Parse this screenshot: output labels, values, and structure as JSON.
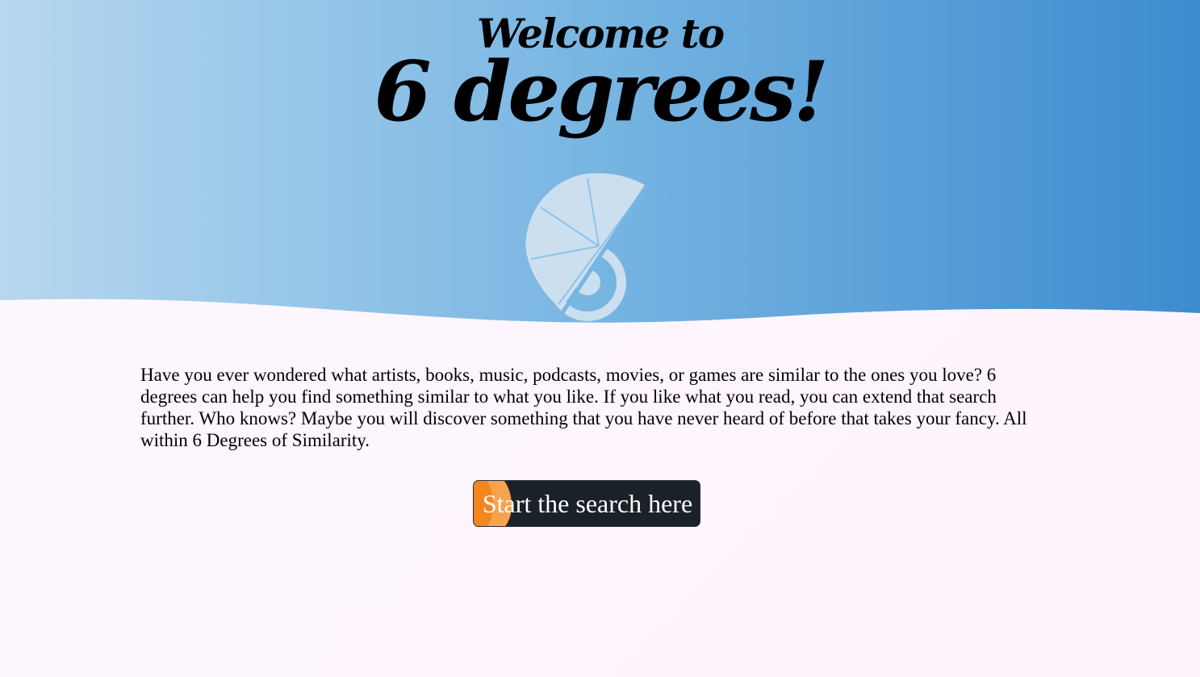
{
  "hero": {
    "welcome": "Welcome to",
    "title": "6 degrees!",
    "gradient_left": "#b7d7ef",
    "gradient_right": "#3d8bcf"
  },
  "logo": {
    "icon": "six-degrees-logo-icon",
    "color": "#cbdfee"
  },
  "intro": {
    "text": "Have you ever wondered what artists, books, music, podcasts, movies, or games are similar to the ones you love? 6 degrees can help you find something similar to what you like. If you like what you read, you can extend that search further. Who knows? Maybe you will discover something that you have never heard of before that takes your fancy. All within 6 Degrees of Similarity."
  },
  "cta": {
    "label": "Start the search here",
    "background": "#1b2128",
    "accent_color": "#f5861f"
  }
}
